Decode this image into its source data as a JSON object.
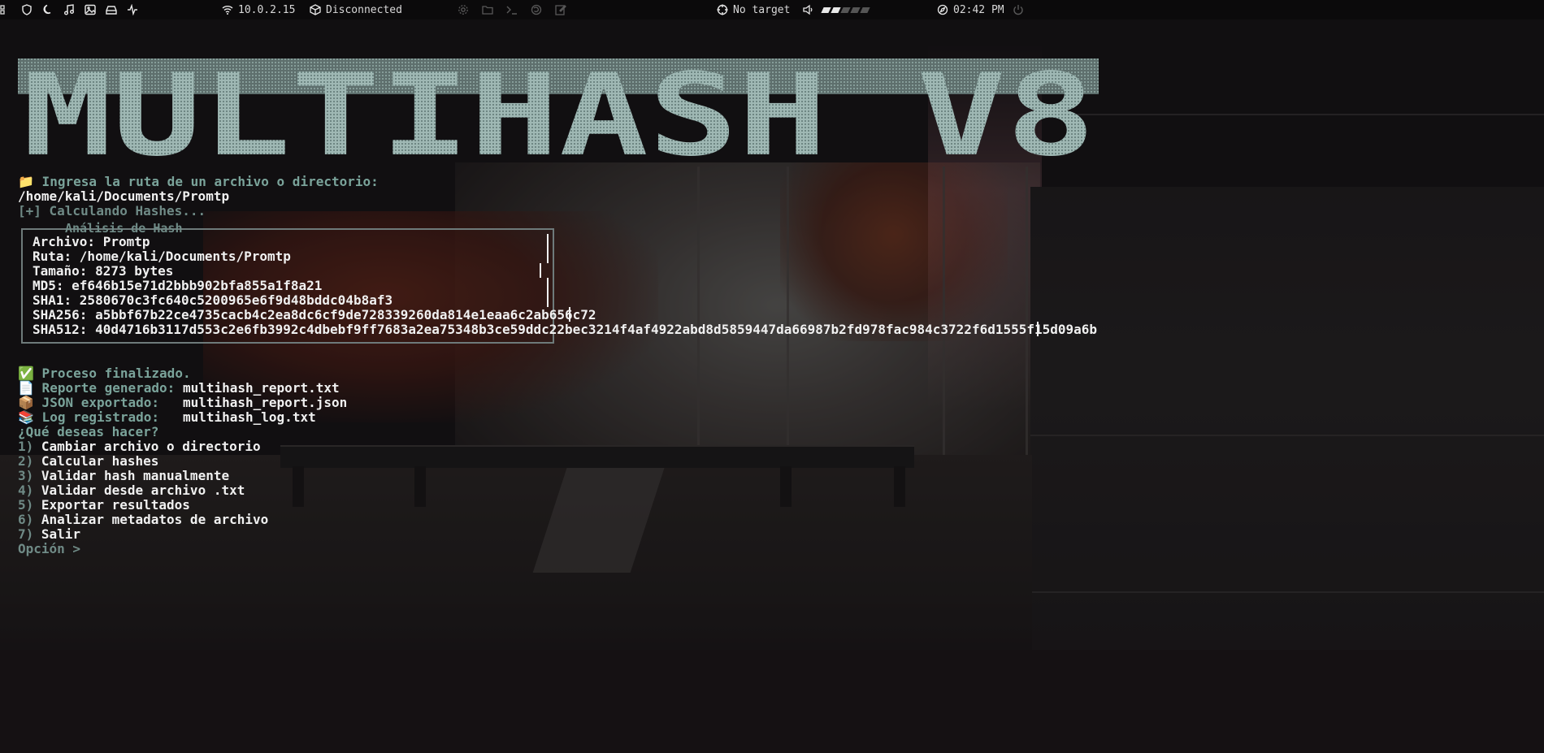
{
  "topbar": {
    "ip": "10.0.2.15",
    "vpn_status": "Disconnected",
    "target": "No target",
    "time": "02:42 PM",
    "volume_level": 0.4,
    "left_icons": [
      "apps-grid-icon",
      "shield-icon",
      "moon-icon",
      "music-icon",
      "image-icon",
      "drive-icon",
      "activity-icon"
    ],
    "center_icons": [
      "gear-icon",
      "folder-icon",
      "terminal-icon",
      "firefox-icon",
      "edit-icon"
    ]
  },
  "title_text": "MULTIHASH V8",
  "prompt": {
    "ask_path": "📁 Ingresa la ruta de un archivo o directorio:",
    "path_input": "/home/kali/Documents/Promtp",
    "calculating": "[+] Calculando Hashes..."
  },
  "analysis": {
    "title": "Análisis de Hash",
    "archivo": "Archivo: Promtp",
    "ruta": "Ruta: /home/kali/Documents/Promtp",
    "tamano": "Tamaño: 8273 bytes",
    "md5": "MD5: ef646b15e71d2bbb902bfa855a1f8a21",
    "sha1": "SHA1: 2580670c3fc640c5200965e6f9d48bddc04b8af3",
    "sha256": "SHA256: a5bbf67b22ce4735cacb4c2ea8dc6cf9de728339260da814e1eaa6c2ab656c72",
    "sha512": "SHA512: 40d4716b3117d553c2e6fb3992c4dbebf9ff7683a2ea75348b3ce59ddc22bec3214f4af4922abd8d5859447da66987b2fd978fac984c3722f6d1555f15d09a6b"
  },
  "result": {
    "finished": "✅ Proceso finalizado.",
    "report_label": "📄 Reporte generado:",
    "report_file": "multihash_report.txt",
    "json_label": "📦 JSON exportado:",
    "json_file": "multihash_report.json",
    "log_label": "📚 Log registrado:",
    "log_file": "multihash_log.txt"
  },
  "menu": {
    "question": "¿Qué deseas hacer?",
    "options": [
      {
        "num": "1)",
        "label": "Cambiar archivo o directorio"
      },
      {
        "num": "2)",
        "label": "Calcular hashes"
      },
      {
        "num": "3)",
        "label": "Validar hash manualmente"
      },
      {
        "num": "4)",
        "label": "Validar desde archivo .txt"
      },
      {
        "num": "5)",
        "label": "Exportar resultados"
      },
      {
        "num": "6)",
        "label": "Analizar metadatos de archivo"
      },
      {
        "num": "7)",
        "label": "Salir"
      }
    ],
    "input_prompt": "Opción >"
  },
  "colors": {
    "accent": "#7aa39a",
    "muted": "#6f8a86",
    "text": "#f0f0f0",
    "title_fill": "#a9c4c0"
  }
}
